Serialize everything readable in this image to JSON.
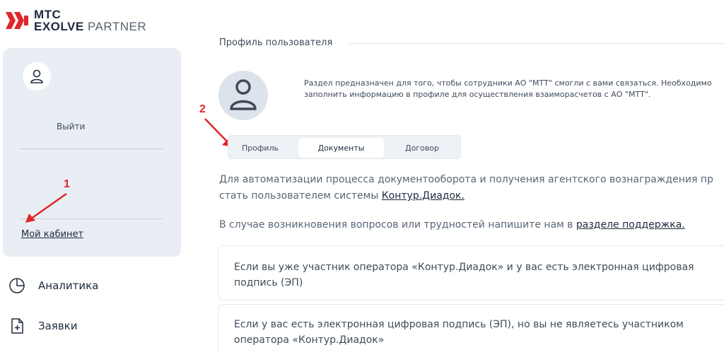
{
  "brand": {
    "line1": "МТС",
    "line2_main": "EXOLVE",
    "line2_sub": "PARTNER",
    "accent_color": "#e0262b"
  },
  "sidebar": {
    "logout_label": "Выйти",
    "placeholder_dots": ". . .",
    "cabinet_link": "Мой кабинет",
    "nav": [
      {
        "label": "Аналитика",
        "icon": "pie-chart-icon"
      },
      {
        "label": "Заявки",
        "icon": "file-plus-icon"
      }
    ]
  },
  "annotations": {
    "one": "1",
    "two": "2"
  },
  "main": {
    "section_title": "Профиль пользователя",
    "profile_info": "Раздел предназначен для того, чтобы сотрудники АО \"МТТ\" смогли с вами связаться. Необходимо заполнить информацию в профиле для осуществления взаиморасчетов с АО \"МТТ\".",
    "tabs": [
      {
        "label": "Профиль",
        "active": false
      },
      {
        "label": "Документы",
        "active": true
      },
      {
        "label": "Договор",
        "active": false
      }
    ],
    "para1_line1": "Для автоматизации процесса документооборота и получения агентского вознаграждения пр",
    "para1_line2_prefix": "стать пользователем системы ",
    "para1_link": "Контур.Диадок.",
    "para2_prefix": "В случае возникновения вопросов или трудностей напишите нам в ",
    "para2_link": "разделе поддержка.",
    "accordions": [
      {
        "text": "Если вы уже участник оператора «Контур.Диадок» и у вас есть электронная цифровая подпись (ЭП)"
      },
      {
        "text": "Если у вас есть электронная цифровая подпись (ЭП), но вы не являетесь участником оператора «Контур.Диадок»"
      }
    ]
  }
}
